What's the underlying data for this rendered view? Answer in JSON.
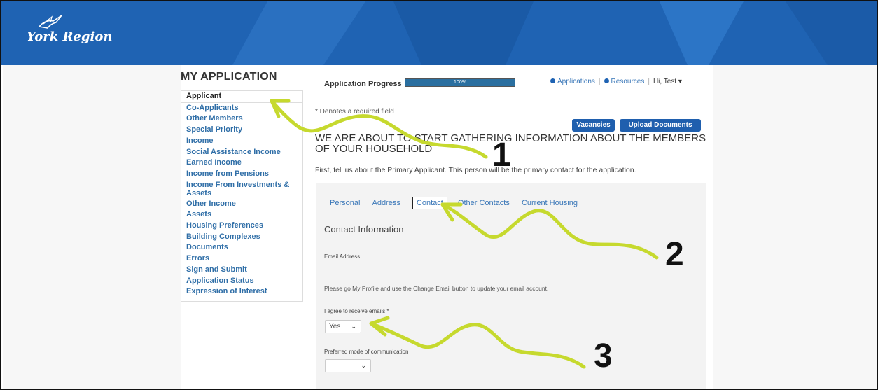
{
  "header": {
    "logo_text": "York Region",
    "brand_color": "#1f63b3"
  },
  "sidebar": {
    "title": "MY APPLICATION",
    "items": [
      {
        "label": "Applicant"
      },
      {
        "label": "Co-Applicants"
      },
      {
        "label": "Other Members"
      },
      {
        "label": "Special Priority"
      },
      {
        "label": "Income"
      },
      {
        "label": "Social Assistance Income"
      },
      {
        "label": "Earned Income"
      },
      {
        "label": "Income from Pensions"
      },
      {
        "label": "Income From Investments & Assets"
      },
      {
        "label": "Other Income"
      },
      {
        "label": "Assets"
      },
      {
        "label": "Housing Preferences"
      },
      {
        "label": "Building Complexes"
      },
      {
        "label": "Documents"
      },
      {
        "label": "Errors"
      },
      {
        "label": "Sign and Submit"
      },
      {
        "label": "Application Status"
      },
      {
        "label": "Expression of Interest"
      }
    ]
  },
  "progress": {
    "label": "Application Progress",
    "value_text": "100%",
    "value": 1.0
  },
  "topnav": {
    "applications": "Applications",
    "resources": "Resources",
    "greeting": "Hi, Test"
  },
  "main": {
    "required_note": "* Denotes a required field",
    "vacancies_button": "Vacancies",
    "upload_button": "Upload Documents",
    "heading": "WE ARE ABOUT TO START GATHERING INFORMATION ABOUT THE MEMBERS OF YOUR HOUSEHOLD",
    "intro": "First, tell us about the Primary Applicant. This person will be the primary contact for the application."
  },
  "tabs": [
    {
      "label": "Personal"
    },
    {
      "label": "Address"
    },
    {
      "label": "Contact"
    },
    {
      "label": "Other Contacts"
    },
    {
      "label": "Current Housing"
    }
  ],
  "form": {
    "section_title": "Contact Information",
    "email_label": "Email Address",
    "help_text": "Please go My Profile and use the Change Email button to update your email account.",
    "agree_label": "I agree to receive emails *",
    "agree_value": "Yes",
    "pref_label": "Preferred mode of communication",
    "pref_value": ""
  },
  "annotations": {
    "n1": "1",
    "n2": "2",
    "n3": "3",
    "arrow_color": "#c6d92e"
  }
}
